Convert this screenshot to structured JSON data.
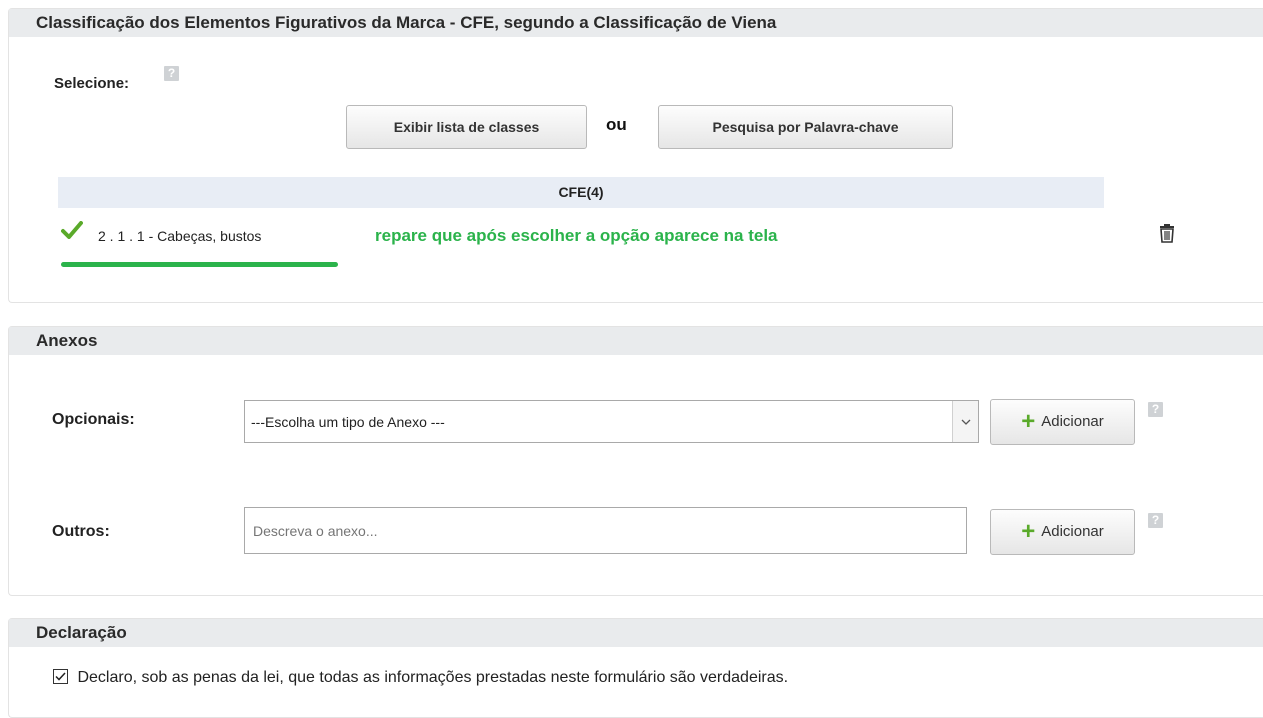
{
  "cfe": {
    "title": "Classificação dos Elementos Figurativos da Marca - CFE, segundo a Classificação de Viena",
    "select_label": "Selecione:",
    "help_glyph": "?",
    "show_classes_button": "Exibir lista de classes",
    "or_text": "ou",
    "keyword_search_button": "Pesquisa por Palavra-chave",
    "table_header": "CFE(4)",
    "selected_item": "2 . 1 . 1 - Cabeças, bustos",
    "annotation": "repare que após escolher a opção aparece na tela",
    "check_icon": "check-icon",
    "trash_icon": "trash-icon"
  },
  "anexos": {
    "title": "Anexos",
    "optional_label": "Opcionais:",
    "optional_select_value": "---Escolha um tipo de Anexo ---",
    "others_label": "Outros:",
    "others_placeholder": "Descreva o anexo...",
    "add_button": "Adicionar"
  },
  "declaracao": {
    "title": "Declaração",
    "checkbox_checked": true,
    "text": "Declaro, sob as penas da lei, que todas as informações prestadas neste formulário são verdadeiras."
  },
  "colors": {
    "annotation_green": "#2bb34b",
    "check_green": "#5aaa2a",
    "header_bg": "#e9ebed",
    "table_header_bg": "#e8edf5"
  }
}
